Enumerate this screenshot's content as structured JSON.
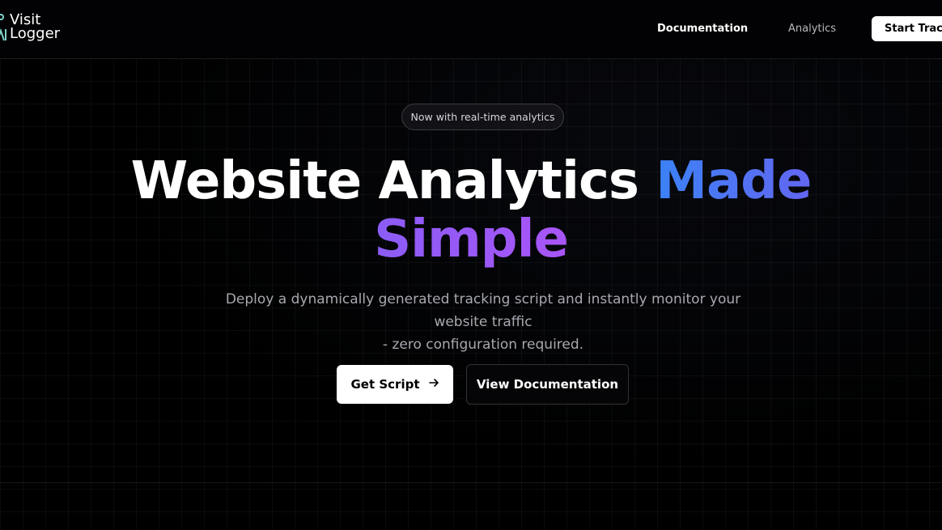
{
  "brand": {
    "name_line1": "Visit",
    "name_line2": "Logger",
    "icon": "person-tracker-icon",
    "icon_color": "#7dd3c8"
  },
  "nav": {
    "documentation": "Documentation",
    "analytics": "Analytics",
    "cta": "Start Tracking"
  },
  "hero": {
    "badge": "Now with real-time analytics",
    "title_plain": "Website Analytics",
    "title_highlight_1": "Made",
    "title_highlight_2": "Simple",
    "subtitle_line1": "Deploy a dynamically generated tracking script and instantly monitor your website traffic",
    "subtitle_line2": "- zero configuration required.",
    "primary_button": "Get Script",
    "primary_button_icon": "arrow-right-icon",
    "secondary_button": "View Documentation"
  },
  "colors": {
    "background": "#000000",
    "gradient_blue": "#3b82f6",
    "gradient_purple": "#a855f7"
  }
}
